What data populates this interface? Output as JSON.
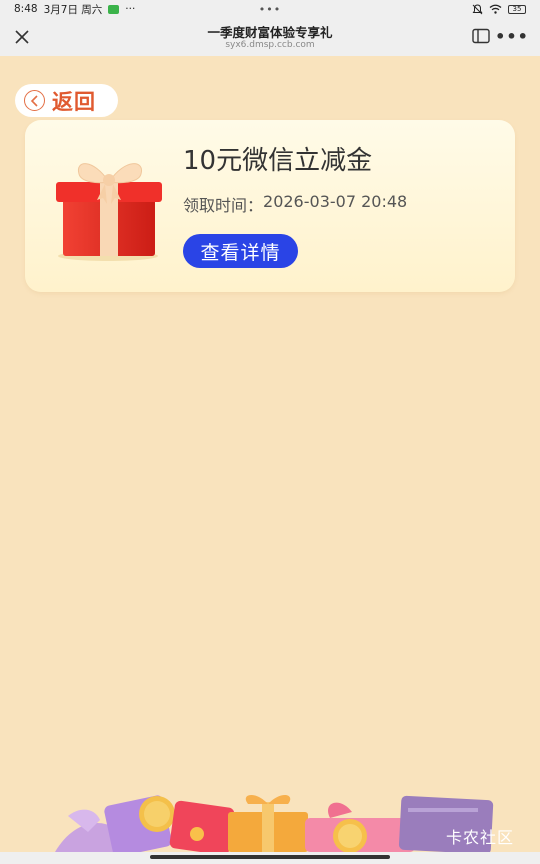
{
  "status_bar": {
    "time": "8:48",
    "date": "3月7日 周六",
    "extra_dots": "···",
    "center_dots": "•••",
    "battery": "35"
  },
  "nav": {
    "title": "一季度财富体验专享礼",
    "url": "syx6.dmsp.ccb.com",
    "more": "•••"
  },
  "back": {
    "label": "返回"
  },
  "reward": {
    "title": "10元微信立减金",
    "time_label": "领取时间：",
    "time_value": "2026-03-07 20:48",
    "button_label": "查看详情"
  },
  "watermark": "卡农社区",
  "colors": {
    "background": "#f9e3bd",
    "accent_button": "#2a44e6",
    "back_text": "#e05a30",
    "card_bg": "#fff5d6"
  },
  "icons": [
    "close-icon",
    "sidebar-icon",
    "more-icon",
    "back-arrow-icon",
    "gift-icon",
    "wifi-icon",
    "mute-icon",
    "battery-icon"
  ]
}
